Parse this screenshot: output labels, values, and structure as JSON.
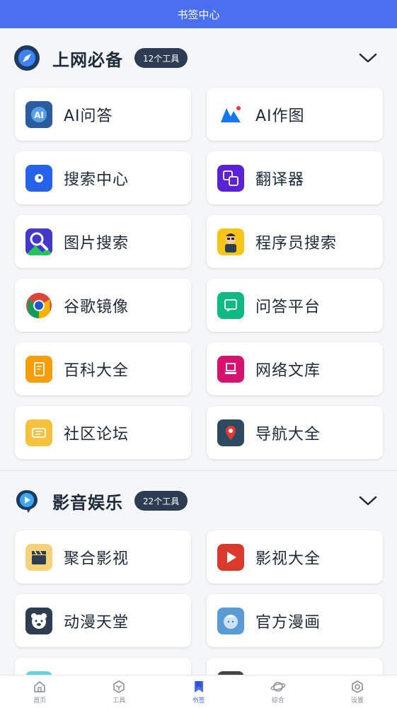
{
  "header": {
    "title": "书签中心"
  },
  "sections": [
    {
      "title": "上网必备",
      "badge": "12个工具",
      "icon": "compass-icon",
      "items": [
        {
          "label": "AI问答",
          "icon": "ai-chip-icon",
          "color": "#3a7bd5"
        },
        {
          "label": "AI作图",
          "icon": "ai-draw-icon",
          "color": "#1877f2"
        },
        {
          "label": "搜索中心",
          "icon": "search-center-icon",
          "color": "#2563eb"
        },
        {
          "label": "翻译器",
          "icon": "translate-icon",
          "color": "#5b21d6"
        },
        {
          "label": "图片搜索",
          "icon": "image-search-icon",
          "color": "#4f46e5"
        },
        {
          "label": "程序员搜索",
          "icon": "programmer-icon",
          "color": "#f5c518"
        },
        {
          "label": "谷歌镜像",
          "icon": "chrome-icon",
          "color": "#4285f4"
        },
        {
          "label": "问答平台",
          "icon": "qa-platform-icon",
          "color": "#10b981"
        },
        {
          "label": "百科大全",
          "icon": "encyclopedia-icon",
          "color": "#f59e0b"
        },
        {
          "label": "网络文库",
          "icon": "library-icon",
          "color": "#d6126e"
        },
        {
          "label": "社区论坛",
          "icon": "forum-icon",
          "color": "#f6c23e"
        },
        {
          "label": "导航大全",
          "icon": "map-pin-icon",
          "color": "#2d4a63"
        }
      ]
    },
    {
      "title": "影音娱乐",
      "badge": "22个工具",
      "icon": "play-bubble-icon",
      "items": [
        {
          "label": "聚合影视",
          "icon": "clapper-icon",
          "color": "#f6c860"
        },
        {
          "label": "影视大全",
          "icon": "play-icon",
          "color": "#d93a2b"
        },
        {
          "label": "动漫天堂",
          "icon": "bear-icon",
          "color": "#2d3e50"
        },
        {
          "label": "官方漫画",
          "icon": "comic-icon",
          "color": "#5b9bd5"
        },
        {
          "label": "",
          "icon": "partial-icon",
          "color": "#6ad0e0"
        },
        {
          "label": "",
          "icon": "partial-icon",
          "color": "#444"
        }
      ]
    }
  ],
  "tabs": [
    {
      "label": "首页",
      "icon": "home-icon"
    },
    {
      "label": "工具",
      "icon": "tool-cube-icon"
    },
    {
      "label": "书签",
      "icon": "bookmark-icon",
      "active": true
    },
    {
      "label": "综合",
      "icon": "planet-icon"
    },
    {
      "label": "设置",
      "icon": "settings-hex-icon"
    }
  ]
}
